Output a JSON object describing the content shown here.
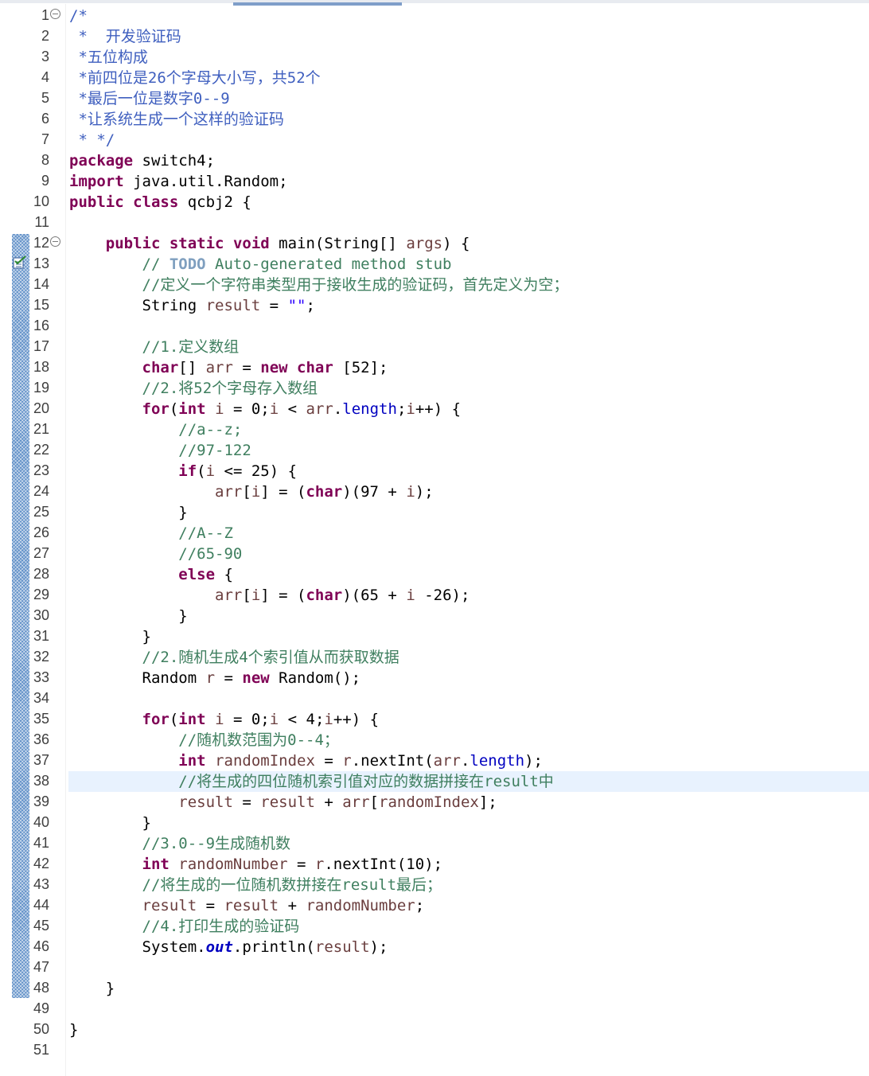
{
  "editor": {
    "lines": [
      {
        "n": "1",
        "text": "/*",
        "kind": "jd"
      },
      {
        "n": "2",
        "text": " *  开发验证码",
        "kind": "jd"
      },
      {
        "n": "3",
        "text": " *五位构成",
        "kind": "jd"
      },
      {
        "n": "4",
        "text": " *前四位是26个字母大小写，共52个",
        "kind": "jd"
      },
      {
        "n": "5",
        "text": " *最后一位是数字0--9",
        "kind": "jd"
      },
      {
        "n": "6",
        "text": " *让系统生成一个这样的验证码",
        "kind": "jd"
      },
      {
        "n": "7",
        "text": " * */",
        "kind": "jd"
      },
      {
        "n": "8",
        "text": "package switch4;",
        "kind": "code"
      },
      {
        "n": "9",
        "text": "import java.util.Random;",
        "kind": "code"
      },
      {
        "n": "10",
        "text": "public class qcbj2 {",
        "kind": "code"
      },
      {
        "n": "11",
        "text": "",
        "kind": "code"
      },
      {
        "n": "12",
        "text": "    public static void main(String[] args) {",
        "kind": "code"
      },
      {
        "n": "13",
        "text": "        // TODO Auto-generated method stub",
        "kind": "cm"
      },
      {
        "n": "14",
        "text": "        //定义一个字符串类型用于接收生成的验证码，首先定义为空；",
        "kind": "cm"
      },
      {
        "n": "15",
        "text": "        String result = \"\";",
        "kind": "code"
      },
      {
        "n": "16",
        "text": "",
        "kind": "code"
      },
      {
        "n": "17",
        "text": "        //1.定义数组",
        "kind": "cm"
      },
      {
        "n": "18",
        "text": "        char[] arr = new char [52];",
        "kind": "code"
      },
      {
        "n": "19",
        "text": "        //2.将52个字母存入数组",
        "kind": "cm"
      },
      {
        "n": "20",
        "text": "        for(int i = 0;i < arr.length;i++) {",
        "kind": "code"
      },
      {
        "n": "21",
        "text": "            //a--z;",
        "kind": "cm"
      },
      {
        "n": "22",
        "text": "            //97-122",
        "kind": "cm"
      },
      {
        "n": "23",
        "text": "            if(i <= 25) {",
        "kind": "code"
      },
      {
        "n": "24",
        "text": "                arr[i] = (char)(97 + i);",
        "kind": "code"
      },
      {
        "n": "25",
        "text": "            }",
        "kind": "code"
      },
      {
        "n": "26",
        "text": "            //A--Z",
        "kind": "cm"
      },
      {
        "n": "27",
        "text": "            //65-90",
        "kind": "cm"
      },
      {
        "n": "28",
        "text": "            else {",
        "kind": "code"
      },
      {
        "n": "29",
        "text": "                arr[i] = (char)(65 + i -26);",
        "kind": "code"
      },
      {
        "n": "30",
        "text": "            }",
        "kind": "code"
      },
      {
        "n": "31",
        "text": "        }",
        "kind": "code"
      },
      {
        "n": "32",
        "text": "        //2.随机生成4个索引值从而获取数据",
        "kind": "cm"
      },
      {
        "n": "33",
        "text": "        Random r = new Random();",
        "kind": "code"
      },
      {
        "n": "34",
        "text": "",
        "kind": "code"
      },
      {
        "n": "35",
        "text": "        for(int i = 0;i < 4;i++) {",
        "kind": "code"
      },
      {
        "n": "36",
        "text": "            //随机数范围为0--4；",
        "kind": "cm"
      },
      {
        "n": "37",
        "text": "            int randomIndex = r.nextInt(arr.length);",
        "kind": "code"
      },
      {
        "n": "38",
        "text": "            //将生成的四位随机索引值对应的数据拼接在result中",
        "kind": "cm"
      },
      {
        "n": "39",
        "text": "            result = result + arr[randomIndex];",
        "kind": "code"
      },
      {
        "n": "40",
        "text": "        }",
        "kind": "code"
      },
      {
        "n": "41",
        "text": "        //3.0--9生成随机数",
        "kind": "cm"
      },
      {
        "n": "42",
        "text": "        int randomNumber = r.nextInt(10);",
        "kind": "code"
      },
      {
        "n": "43",
        "text": "        //将生成的一位随机数拼接在result最后；",
        "kind": "cm"
      },
      {
        "n": "44",
        "text": "        result = result + randomNumber;",
        "kind": "code"
      },
      {
        "n": "45",
        "text": "        //4.打印生成的验证码",
        "kind": "cm"
      },
      {
        "n": "46",
        "text": "        System.out.println(result);",
        "kind": "code"
      },
      {
        "n": "47",
        "text": "",
        "kind": "code"
      },
      {
        "n": "48",
        "text": "    }",
        "kind": "code"
      },
      {
        "n": "49",
        "text": "",
        "kind": "code"
      },
      {
        "n": "50",
        "text": "}",
        "kind": "code"
      },
      {
        "n": "51",
        "text": "",
        "kind": "code"
      }
    ],
    "current_line": "38",
    "fold_lines": [
      "1",
      "12"
    ],
    "task_marker_line": "13",
    "task_marker_icon": "task-checkbox-icon",
    "fold_icon": "collapse-minus-icon",
    "colors": {
      "keyword": "#7f0055",
      "comment": "#3f7f5f",
      "javadoc": "#3f5fbf",
      "string": "#2a00ff",
      "field": "#0000c0",
      "local_var": "#6a3e3e",
      "current_line_bg": "#e8f2fe",
      "change_bar": "#5f8fc7"
    }
  }
}
